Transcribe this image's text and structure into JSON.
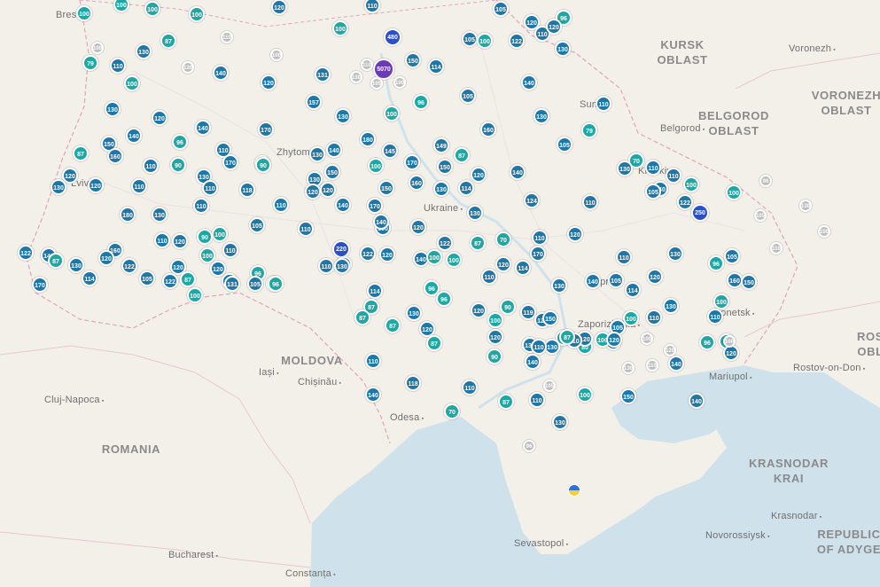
{
  "map": {
    "colors": {
      "land": "#f3f0ea",
      "sea": "#cfe2ec",
      "border": "#e2a3b8",
      "marker_blue": "#1f77a8",
      "marker_teal": "#1fa7a4",
      "marker_grey": "#bdbdbd"
    },
    "regions": [
      "KURSK\nOBLAST",
      "BELGOROD\nOBLAST",
      "VORONEZH\nOBLAST",
      "ROS\nOBL",
      "MOLDOVA",
      "ROMANIA",
      "KRASNODAR\nKRAI",
      "REPUBLIC\nOF ADYGE"
    ],
    "cities": [
      "Brest",
      "Voronezh",
      "Belgorod",
      "Zhytomyr",
      "Lviv",
      "Kharkiv",
      "Sumy",
      "Dnipro",
      "Donetsk",
      "Zaporizhzhia",
      "Mariupol",
      "Iași",
      "Chișinău",
      "Cluj-Napoca",
      "Odesa",
      "Rostov-on-Don",
      "Sevastopol",
      "Krasnodar",
      "Novorossiysk",
      "Bucharest",
      "Constanța",
      "Ukraine"
    ],
    "markers": [
      {
        "v": "100",
        "c": "teal"
      },
      {
        "v": "100",
        "c": "teal"
      },
      {
        "v": "100",
        "c": "teal"
      },
      {
        "v": "100",
        "c": "teal"
      },
      {
        "v": "120",
        "c": "blue"
      },
      {
        "v": "110",
        "c": "blue"
      },
      {
        "v": "105",
        "c": "blue"
      },
      {
        "v": "120",
        "c": "blue"
      },
      {
        "v": "96",
        "c": "teal"
      },
      {
        "v": "100",
        "c": "teal"
      },
      {
        "v": "480",
        "c": "dark"
      },
      {
        "v": "5070",
        "c": "purple"
      },
      {
        "v": "105",
        "c": "blue"
      },
      {
        "v": "100",
        "c": "teal"
      },
      {
        "v": "122",
        "c": "blue"
      },
      {
        "v": "110",
        "c": "blue"
      },
      {
        "v": "120",
        "c": "blue"
      },
      {
        "v": "130",
        "c": "blue"
      },
      {
        "v": "87",
        "c": "teal"
      },
      {
        "v": "79",
        "c": "teal"
      },
      {
        "v": "110",
        "c": "blue"
      },
      {
        "v": "130",
        "c": "blue"
      },
      {
        "v": "100",
        "c": "teal"
      },
      {
        "v": "140",
        "c": "blue"
      },
      {
        "v": "120",
        "c": "blue"
      },
      {
        "v": "131",
        "c": "blue"
      },
      {
        "v": "150",
        "c": "blue"
      },
      {
        "v": "114",
        "c": "blue"
      },
      {
        "v": "105",
        "c": "blue"
      },
      {
        "v": "157",
        "c": "blue"
      },
      {
        "v": "96",
        "c": "teal"
      },
      {
        "v": "140",
        "c": "blue"
      },
      {
        "v": "110",
        "c": "blue"
      },
      {
        "v": "130",
        "c": "blue"
      },
      {
        "v": "120",
        "c": "blue"
      },
      {
        "v": "140",
        "c": "blue"
      },
      {
        "v": "170",
        "c": "blue"
      },
      {
        "v": "130",
        "c": "blue"
      },
      {
        "v": "100",
        "c": "teal"
      },
      {
        "v": "160",
        "c": "blue"
      },
      {
        "v": "130",
        "c": "blue"
      },
      {
        "v": "79",
        "c": "teal"
      },
      {
        "v": "105",
        "c": "blue"
      },
      {
        "v": "150",
        "c": "blue"
      },
      {
        "v": "140",
        "c": "blue"
      },
      {
        "v": "96",
        "c": "teal"
      },
      {
        "v": "110",
        "c": "blue"
      },
      {
        "v": "170",
        "c": "blue"
      },
      {
        "v": "130",
        "c": "blue"
      },
      {
        "v": "140",
        "c": "blue"
      },
      {
        "v": "150",
        "c": "blue"
      },
      {
        "v": "180",
        "c": "blue"
      },
      {
        "v": "145",
        "c": "blue"
      },
      {
        "v": "149",
        "c": "blue"
      },
      {
        "v": "87",
        "c": "teal"
      },
      {
        "v": "100",
        "c": "teal"
      },
      {
        "v": "70",
        "c": "teal"
      },
      {
        "v": "110",
        "c": "blue"
      },
      {
        "v": "130",
        "c": "blue"
      },
      {
        "v": "87",
        "c": "teal"
      },
      {
        "v": "160",
        "c": "blue"
      },
      {
        "v": "110",
        "c": "blue"
      },
      {
        "v": "90",
        "c": "teal"
      },
      {
        "v": "100",
        "c": "teal"
      },
      {
        "v": "170",
        "c": "blue"
      },
      {
        "v": "150",
        "c": "blue"
      },
      {
        "v": "120",
        "c": "blue"
      },
      {
        "v": "140",
        "c": "blue"
      },
      {
        "v": "120",
        "c": "blue"
      },
      {
        "v": "120",
        "c": "blue"
      },
      {
        "v": "110",
        "c": "blue"
      },
      {
        "v": "130",
        "c": "blue"
      },
      {
        "v": "110",
        "c": "blue"
      },
      {
        "v": "122",
        "c": "blue"
      },
      {
        "v": "100",
        "c": "teal"
      },
      {
        "v": "110",
        "c": "blue"
      },
      {
        "v": "130",
        "c": "blue"
      },
      {
        "v": "118",
        "c": "blue"
      },
      {
        "v": "110",
        "c": "blue"
      },
      {
        "v": "90",
        "c": "teal"
      },
      {
        "v": "130",
        "c": "blue"
      },
      {
        "v": "170",
        "c": "blue"
      },
      {
        "v": "120",
        "c": "blue"
      },
      {
        "v": "120",
        "c": "blue"
      },
      {
        "v": "150",
        "c": "blue"
      },
      {
        "v": "160",
        "c": "blue"
      },
      {
        "v": "130",
        "c": "blue"
      },
      {
        "v": "114",
        "c": "blue"
      },
      {
        "v": "124",
        "c": "blue"
      },
      {
        "v": "110",
        "c": "blue"
      },
      {
        "v": "250",
        "c": "dark"
      },
      {
        "v": "130",
        "c": "blue"
      },
      {
        "v": "100",
        "c": "teal"
      },
      {
        "v": "140",
        "c": "blue"
      },
      {
        "v": "105",
        "c": "blue"
      },
      {
        "v": "180",
        "c": "blue"
      },
      {
        "v": "130",
        "c": "blue"
      },
      {
        "v": "110",
        "c": "blue"
      },
      {
        "v": "105",
        "c": "blue"
      },
      {
        "v": "160",
        "c": "blue"
      },
      {
        "v": "140",
        "c": "blue"
      },
      {
        "v": "100",
        "c": "teal"
      },
      {
        "v": "110",
        "c": "blue"
      },
      {
        "v": "150",
        "c": "blue"
      },
      {
        "v": "120",
        "c": "blue"
      },
      {
        "v": "122",
        "c": "blue"
      },
      {
        "v": "87",
        "c": "teal"
      },
      {
        "v": "70",
        "c": "teal"
      },
      {
        "v": "120",
        "c": "blue"
      },
      {
        "v": "110",
        "c": "blue"
      },
      {
        "v": "220",
        "c": "dark"
      },
      {
        "v": "140",
        "c": "blue"
      },
      {
        "v": "100",
        "c": "teal"
      },
      {
        "v": "140",
        "c": "blue"
      },
      {
        "v": "110",
        "c": "blue"
      },
      {
        "v": "122",
        "c": "blue"
      },
      {
        "v": "120",
        "c": "blue"
      },
      {
        "v": "140",
        "c": "blue"
      },
      {
        "v": "122",
        "c": "blue"
      },
      {
        "v": "130",
        "c": "blue"
      },
      {
        "v": "120",
        "c": "blue"
      },
      {
        "v": "100",
        "c": "teal"
      },
      {
        "v": "96",
        "c": "teal"
      },
      {
        "v": "87",
        "c": "teal"
      },
      {
        "v": "110",
        "c": "blue"
      },
      {
        "v": "120",
        "c": "blue"
      },
      {
        "v": "90",
        "c": "teal"
      },
      {
        "v": "120",
        "c": "blue"
      },
      {
        "v": "114",
        "c": "blue"
      },
      {
        "v": "130",
        "c": "blue"
      },
      {
        "v": "110",
        "c": "blue"
      },
      {
        "v": "122",
        "c": "blue"
      },
      {
        "v": "105",
        "c": "blue"
      },
      {
        "v": "120",
        "c": "blue"
      },
      {
        "v": "100",
        "c": "teal"
      },
      {
        "v": "120",
        "c": "blue"
      },
      {
        "v": "114",
        "c": "blue"
      },
      {
        "v": "170",
        "c": "blue"
      },
      {
        "v": "130",
        "c": "blue"
      },
      {
        "v": "140",
        "c": "blue"
      },
      {
        "v": "110",
        "c": "blue"
      },
      {
        "v": "105",
        "c": "blue"
      },
      {
        "v": "114",
        "c": "blue"
      },
      {
        "v": "120",
        "c": "blue"
      },
      {
        "v": "130",
        "c": "blue"
      },
      {
        "v": "96",
        "c": "teal"
      },
      {
        "v": "105",
        "c": "blue"
      },
      {
        "v": "160",
        "c": "blue"
      },
      {
        "v": "150",
        "c": "blue"
      },
      {
        "v": "114",
        "c": "blue"
      },
      {
        "v": "170",
        "c": "blue"
      },
      {
        "v": "105",
        "c": "blue"
      },
      {
        "v": "122",
        "c": "blue"
      },
      {
        "v": "87",
        "c": "teal"
      },
      {
        "v": "100",
        "c": "teal"
      },
      {
        "v": "131",
        "c": "blue"
      },
      {
        "v": "105",
        "c": "blue"
      },
      {
        "v": "96",
        "c": "teal"
      },
      {
        "v": "130",
        "c": "blue"
      },
      {
        "v": "114",
        "c": "blue"
      },
      {
        "v": "96",
        "c": "teal"
      },
      {
        "v": "110",
        "c": "blue"
      },
      {
        "v": "130",
        "c": "blue"
      },
      {
        "v": "96",
        "c": "teal"
      },
      {
        "v": "87",
        "c": "teal"
      },
      {
        "v": "87",
        "c": "teal"
      },
      {
        "v": "120",
        "c": "blue"
      },
      {
        "v": "87",
        "c": "teal"
      },
      {
        "v": "90",
        "c": "teal"
      },
      {
        "v": "119",
        "c": "blue"
      },
      {
        "v": "120",
        "c": "blue"
      },
      {
        "v": "100",
        "c": "teal"
      },
      {
        "v": "120",
        "c": "blue"
      },
      {
        "v": "80",
        "c": "teal"
      },
      {
        "v": "80",
        "c": "teal"
      },
      {
        "v": "130",
        "c": "blue"
      },
      {
        "v": "100",
        "c": "teal"
      },
      {
        "v": "110",
        "c": "blue"
      },
      {
        "v": "130",
        "c": "blue"
      },
      {
        "v": "100",
        "c": "teal"
      },
      {
        "v": "110",
        "c": "blue"
      },
      {
        "v": "96",
        "c": "teal"
      },
      {
        "v": "96",
        "c": "teal"
      },
      {
        "v": "120",
        "c": "blue"
      },
      {
        "v": "140",
        "c": "blue"
      },
      {
        "v": "105",
        "c": "blue"
      },
      {
        "v": "100",
        "c": "teal"
      },
      {
        "v": "120",
        "c": "blue"
      },
      {
        "v": "130",
        "c": "blue"
      },
      {
        "v": "110",
        "c": "blue"
      },
      {
        "v": "90",
        "c": "teal"
      },
      {
        "v": "140",
        "c": "blue"
      },
      {
        "v": "110",
        "c": "blue"
      },
      {
        "v": "87",
        "c": "teal"
      },
      {
        "v": "120",
        "c": "blue"
      },
      {
        "v": "130",
        "c": "blue"
      },
      {
        "v": "150",
        "c": "blue"
      },
      {
        "v": "110",
        "c": "blue"
      },
      {
        "v": "87",
        "c": "teal"
      },
      {
        "v": "120",
        "c": "blue"
      },
      {
        "v": "140",
        "c": "blue"
      },
      {
        "v": "118",
        "c": "blue"
      },
      {
        "v": "110",
        "c": "blue"
      },
      {
        "v": "70",
        "c": "teal"
      },
      {
        "v": "87",
        "c": "teal"
      },
      {
        "v": "110",
        "c": "blue"
      },
      {
        "v": "100",
        "c": "teal"
      },
      {
        "v": "150",
        "c": "blue"
      },
      {
        "v": "130",
        "c": "blue"
      },
      {
        "v": "140",
        "c": "blue"
      }
    ],
    "grey_markers": [
      "100",
      "120",
      "110",
      "100",
      "130",
      "110",
      "105",
      "100",
      "96",
      "130",
      "100",
      "110",
      "105",
      "100",
      "120",
      "130",
      "110",
      "100",
      "96",
      "105"
    ]
  }
}
